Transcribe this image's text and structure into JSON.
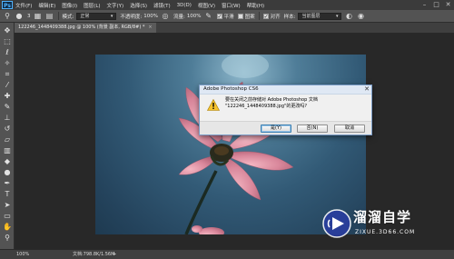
{
  "app": {
    "logo": "Ps"
  },
  "menubar": {
    "items": [
      "文件(F)",
      "编辑(E)",
      "图像(I)",
      "图层(L)",
      "文字(Y)",
      "选择(S)",
      "滤镜(T)",
      "3D(D)",
      "视图(V)",
      "窗口(W)",
      "帮助(H)"
    ]
  },
  "window_controls": {
    "minimize": "–",
    "maximize": "□",
    "close": "✕"
  },
  "options": {
    "brush_size": "3",
    "mode_label": "模式:",
    "mode_value": "正常",
    "opacity_label": "不透明度:",
    "opacity_value": "100%",
    "flow_label": "流量:",
    "flow_value": "100%",
    "smooth_label": "平滑",
    "align_label": "对齐",
    "sample_label": "样本:",
    "sample_value": "当前图层",
    "other_label": "图案"
  },
  "document": {
    "tab_title": "122246_1448409388.jpg @ 100% (背景 副本, RGB/8#) *",
    "tab_close": "×"
  },
  "dialog": {
    "title": "Adobe Photoshop CS6",
    "close": "✕",
    "message_line1": "要在关闭之前存储对 Adobe Photoshop 文档",
    "message_line2": "\"122246_1448409388.jpg\"的更改吗?",
    "buttons": {
      "yes": "是(Y)",
      "no": "否(N)",
      "cancel": "取消"
    }
  },
  "status": {
    "zoom": "100%",
    "doc_size": "文档:798.8K/1.56M",
    "arrow": "▸"
  },
  "watermark": {
    "text": "溜溜自学",
    "subtext": "ZIXUE.3D66.COM"
  },
  "tools": [
    "move-icon",
    "marquee-icon",
    "lasso-icon",
    "quick-select-icon",
    "crop-icon",
    "eyedropper-icon",
    "healing-icon",
    "brush-icon",
    "clone-stamp-icon",
    "history-brush-icon",
    "eraser-icon",
    "gradient-icon",
    "blur-icon",
    "dodge-icon",
    "pen-icon",
    "type-icon",
    "path-select-icon",
    "shape-icon",
    "hand-icon",
    "zoom-icon"
  ],
  "colors": {
    "accent": "#4fb3ff",
    "dialog_border": "#7a9cc6",
    "watermark_bg": "#2a3ea0"
  }
}
